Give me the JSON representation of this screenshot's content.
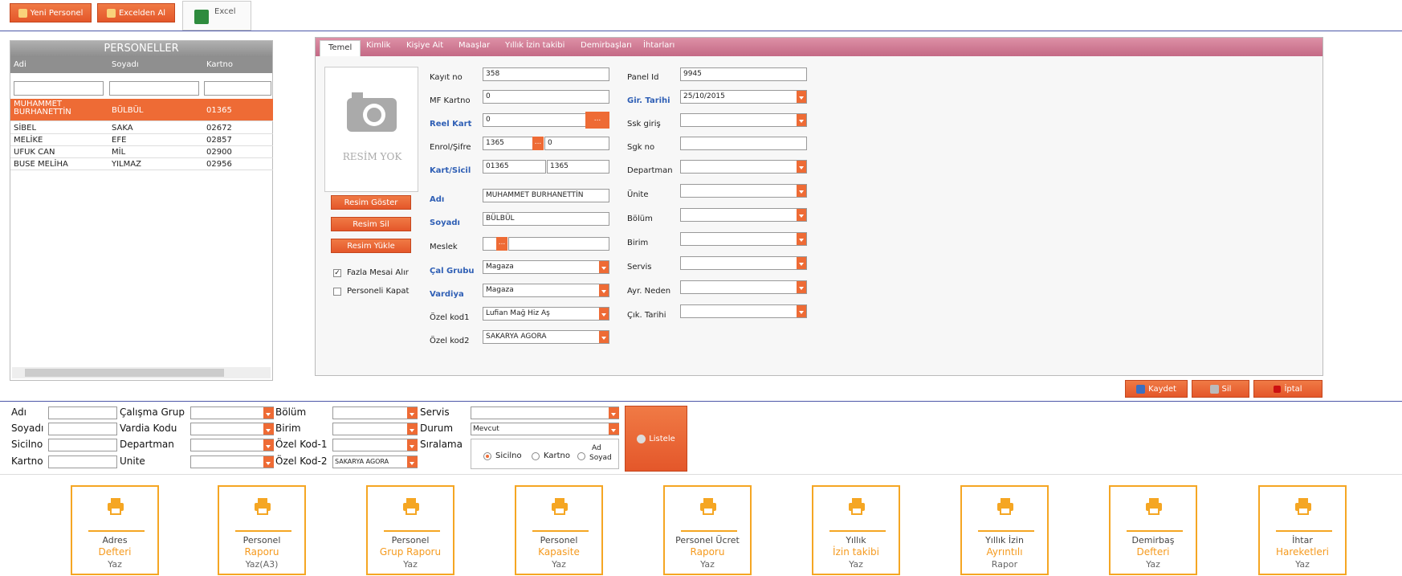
{
  "toolbar": {
    "new_personnel": "Yeni Personel",
    "import_excel": "Excelden Al",
    "excel": "Excel"
  },
  "list": {
    "title": "PERSONELLER",
    "columns": [
      "Adi",
      "Soyadı",
      "Kartno"
    ],
    "rows": [
      {
        "name": "MUHAMMET BURHANETTİN",
        "surname": "BÜLBÜL",
        "card": "01365"
      },
      {
        "name": "SİBEL",
        "surname": "SAKA",
        "card": "02672"
      },
      {
        "name": "MELİKE",
        "surname": "EFE",
        "card": "02857"
      },
      {
        "name": "UFUK CAN",
        "surname": "MİL",
        "card": "02900"
      },
      {
        "name": "BUSE MELİHA",
        "surname": "YILMAZ",
        "card": "02956"
      }
    ]
  },
  "tabs": [
    "Temel",
    "Kimlik",
    "Kişiye Ait",
    "Maaşlar",
    "Yıllık İzin takibi",
    "Demirbaşları",
    "İhtarları"
  ],
  "photo": {
    "no_photo": "RESİM YOK",
    "show": "Resim Göster",
    "delete": "Resim Sil",
    "upload": "Resim Yükle"
  },
  "options": {
    "overtime": "Fazla Mesai Alır",
    "close": "Personeli Kapat"
  },
  "form": {
    "kayit_no": {
      "label": "Kayıt no",
      "value": "358"
    },
    "mf_kartno": {
      "label": "MF Kartno",
      "value": "0"
    },
    "reel_kart": {
      "label": "Reel Kart",
      "value": "0"
    },
    "enrol": {
      "label": "Enrol/Şifre",
      "value": "1365",
      "value2": "0"
    },
    "kart_sicil": {
      "label": "Kart/Sicil",
      "value": "01365",
      "value2": "1365"
    },
    "adi": {
      "label": "Adı",
      "value": "MUHAMMET BURHANETTİN"
    },
    "soyadi": {
      "label": "Soyadı",
      "value": "BÜLBÜL"
    },
    "meslek": {
      "label": "Meslek",
      "value": ""
    },
    "cal_grubu": {
      "label": "Çal Grubu",
      "value": "Magaza"
    },
    "vardiya": {
      "label": "Vardiya",
      "value": "Magaza"
    },
    "ozel_kod1": {
      "label": "Özel kod1",
      "value": "Lufian Mağ Hiz Aş"
    },
    "ozel_kod2": {
      "label": "Özel kod2",
      "value": "SAKARYA AGORA"
    },
    "panel_id": {
      "label": "Panel Id",
      "value": "9945"
    },
    "gir_tarihi": {
      "label": "Gir. Tarihi",
      "value": "25/10/2015"
    },
    "ssk_giris": {
      "label": "Ssk giriş",
      "value": ""
    },
    "sgk_no": {
      "label": "Sgk no",
      "value": ""
    },
    "departman": {
      "label": "Departman",
      "value": ""
    },
    "unite": {
      "label": "Ünite",
      "value": ""
    },
    "bolum": {
      "label": "Bölüm",
      "value": ""
    },
    "birim": {
      "label": "Birim",
      "value": ""
    },
    "servis": {
      "label": "Servis",
      "value": ""
    },
    "ayr_neden": {
      "label": "Ayr. Neden",
      "value": ""
    },
    "cik_tarihi": {
      "label": "Çık. Tarihi",
      "value": ""
    }
  },
  "actions": {
    "save": "Kaydet",
    "delete": "Sil",
    "cancel": "İptal"
  },
  "filter": {
    "adi": "Adı",
    "soyadi": "Soyadı",
    "sicilno": "Sicilno",
    "kartno": "Kartno",
    "calisma_grup": "Çalışma Grup",
    "vardia_kodu": "Vardia Kodu",
    "departman": "Departman",
    "unite": "Unite",
    "bolum": "Bölüm",
    "birim": "Birim",
    "ozel_kod1": "Özel Kod-1",
    "ozel_kod2": "Özel Kod-2",
    "ozel_kod2_value": "SAKARYA AGORA",
    "servis": "Servis",
    "durum": "Durum",
    "durum_value": "Mevcut",
    "siralama": "Sıralama",
    "sort_sicilno": "Sicilno",
    "sort_kartno": "Kartno",
    "sort_ad1": "Ad",
    "sort_ad2": "Soyad",
    "list_button": "Listele"
  },
  "reports": [
    {
      "l1": "Adres",
      "l2": "Defteri",
      "l3": "Yaz"
    },
    {
      "l1": "Personel",
      "l2": "Raporu",
      "l3": "Yaz(A3)"
    },
    {
      "l1": "Personel",
      "l2": "Grup Raporu",
      "l3": "Yaz"
    },
    {
      "l1": "Personel",
      "l2": "Kapasite",
      "l3": "Yaz"
    },
    {
      "l1": "Personel Ücret",
      "l2": "Raporu",
      "l3": "Yaz"
    },
    {
      "l1": "Yıllık",
      "l2": "İzin takibi",
      "l3": "Yaz"
    },
    {
      "l1": "Yıllık İzin",
      "l2": "Ayrıntılı",
      "l3": "Rapor"
    },
    {
      "l1": "Demirbaş",
      "l2": "Defteri",
      "l3": "Yaz"
    },
    {
      "l1": "İhtar",
      "l2": "Hareketleri",
      "l3": "Yaz"
    }
  ],
  "colors": {
    "accent": "#ee6b35",
    "tabbar": "#c46985",
    "report": "#f5a623",
    "link_blue": "#2f5fb5"
  }
}
